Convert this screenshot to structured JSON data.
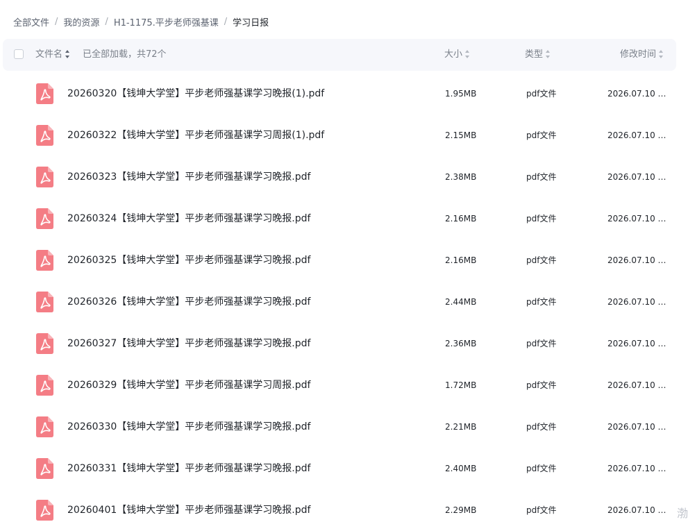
{
  "breadcrumb": {
    "items": [
      "全部文件",
      "我的资源",
      "H1-1175.平步老师强基课"
    ],
    "separator": "/",
    "current": "学习日报"
  },
  "header": {
    "name_label": "文件名",
    "count_text": "已全部加载，共72个",
    "size_label": "大小",
    "type_label": "类型",
    "time_label": "修改时间"
  },
  "files": [
    {
      "name": "20260320【钱坤大学堂】平步老师强基课学习晚报(1).pdf",
      "size": "1.95MB",
      "type": "pdf文件",
      "time": "2026.07.10 0..."
    },
    {
      "name": "20260322【钱坤大学堂】平步老师强基课学习周报(1).pdf",
      "size": "2.15MB",
      "type": "pdf文件",
      "time": "2026.07.10 0..."
    },
    {
      "name": "20260323【钱坤大学堂】平步老师强基课学习晚报.pdf",
      "size": "2.38MB",
      "type": "pdf文件",
      "time": "2026.07.10 0..."
    },
    {
      "name": "20260324【钱坤大学堂】平步老师强基课学习晚报.pdf",
      "size": "2.16MB",
      "type": "pdf文件",
      "time": "2026.07.10 0..."
    },
    {
      "name": "20260325【钱坤大学堂】平步老师强基课学习晚报.pdf",
      "size": "2.16MB",
      "type": "pdf文件",
      "time": "2026.07.10 0..."
    },
    {
      "name": "20260326【钱坤大学堂】平步老师强基课学习晚报.pdf",
      "size": "2.44MB",
      "type": "pdf文件",
      "time": "2026.07.10 0..."
    },
    {
      "name": "20260327【钱坤大学堂】平步老师强基课学习晚报.pdf",
      "size": "2.36MB",
      "type": "pdf文件",
      "time": "2026.07.10 0..."
    },
    {
      "name": "20260329【钱坤大学堂】平步老师强基课学习周报.pdf",
      "size": "1.72MB",
      "type": "pdf文件",
      "time": "2026.07.10 0..."
    },
    {
      "name": "20260330【钱坤大学堂】平步老师强基课学习晚报.pdf",
      "size": "2.21MB",
      "type": "pdf文件",
      "time": "2026.07.10 0..."
    },
    {
      "name": "20260331【钱坤大学堂】平步老师强基课学习晚报.pdf",
      "size": "2.40MB",
      "type": "pdf文件",
      "time": "2026.07.10 0..."
    },
    {
      "name": "20260401【钱坤大学堂】平步老师强基课学习晚报.pdf",
      "size": "2.29MB",
      "type": "pdf文件",
      "time": "2026.07.10 0..."
    }
  ],
  "corner_text": "渤",
  "icons": {
    "file": "pdf-file-icon",
    "sort": "sort-icon",
    "checkbox": "checkbox"
  },
  "colors": {
    "pdf_icon": "#f47d85",
    "header_bg": "#f6f7fb",
    "text": "#1f2329",
    "muted": "#7a808a"
  }
}
